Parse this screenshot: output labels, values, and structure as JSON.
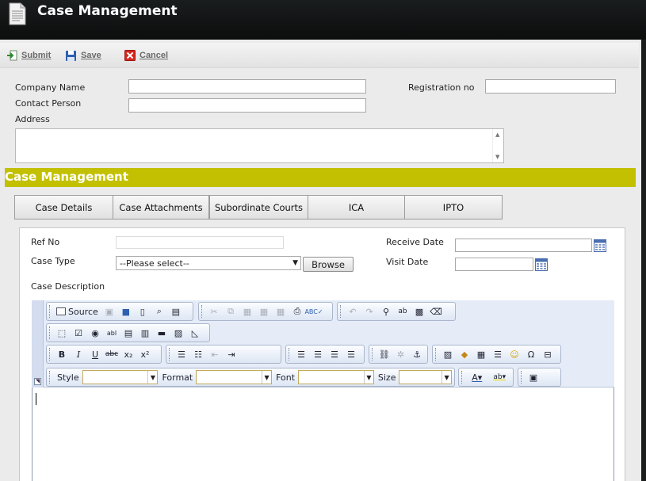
{
  "window": {
    "title": "Case Management"
  },
  "actions": {
    "submit": "Submit",
    "save": "Save",
    "cancel": "Cancel"
  },
  "company": {
    "company_name_label": "Company Name",
    "company_name_value": "",
    "registration_label": "Registration no",
    "registration_value": "",
    "contact_label": "Contact Person",
    "contact_value": "",
    "address_label": "Address",
    "address_value": ""
  },
  "section": {
    "title": "Case Management"
  },
  "tabs": [
    {
      "label": "Case Details"
    },
    {
      "label": "Case Attachments"
    },
    {
      "label": "Subordinate Courts"
    },
    {
      "label": "ICA"
    },
    {
      "label": "IPTO"
    }
  ],
  "case": {
    "ref_no_label": "Ref No",
    "ref_no_value": "",
    "receive_date_label": "Receive Date",
    "receive_date_value": "",
    "case_type_label": "Case Type",
    "case_type_selected": "--Please select--",
    "browse_label": "Browse",
    "visit_date_label": "Visit Date",
    "visit_date_value": "",
    "description_label": "Case Description"
  },
  "editor": {
    "source_label": "Source",
    "bold": "B",
    "italic": "I",
    "underline": "U",
    "strike": "abc",
    "subscript": "x₂",
    "superscript": "x²",
    "style_label": "Style",
    "format_label": "Format",
    "font_label": "Font",
    "size_label": "Size",
    "icons": [
      "source-icon",
      "save-doc-icon",
      "new-page-icon",
      "preview-icon",
      "templates-icon",
      "cut-icon",
      "copy-icon",
      "paste-icon",
      "paste-text-icon",
      "paste-word-icon",
      "print-icon",
      "spellcheck-icon",
      "undo-icon",
      "redo-icon",
      "find-icon",
      "replace-icon",
      "select-all-icon",
      "remove-format-icon",
      "form-icon",
      "checkbox-icon",
      "radio-icon",
      "text-field-icon",
      "textarea-icon",
      "select-field-icon",
      "button-icon",
      "image-button-icon",
      "hidden-field-icon",
      "numbered-list-icon",
      "bulleted-list-icon",
      "outdent-icon",
      "indent-icon",
      "align-left-icon",
      "align-center-icon",
      "align-right-icon",
      "justify-icon",
      "link-icon",
      "unlink-icon",
      "anchor-icon",
      "image-icon",
      "flash-icon",
      "table-icon",
      "horizontal-rule-icon",
      "smiley-icon",
      "special-char-icon",
      "page-break-icon",
      "text-color-icon",
      "bg-color-icon",
      "show-blocks-icon"
    ]
  }
}
